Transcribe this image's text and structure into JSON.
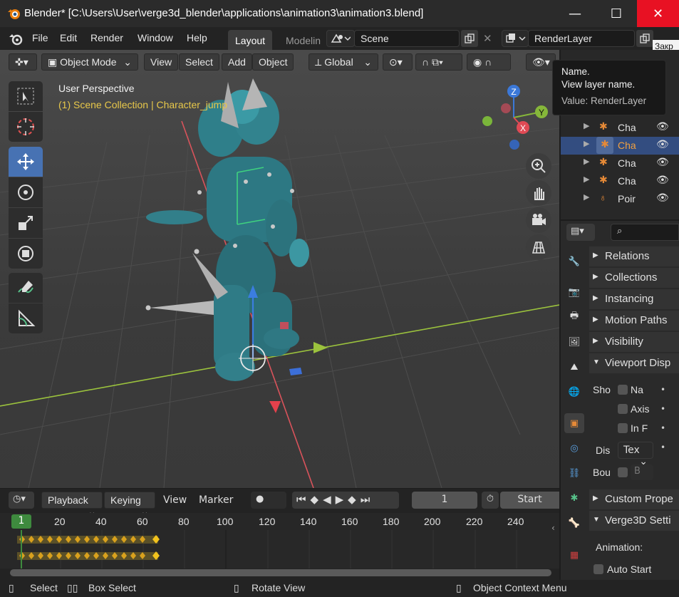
{
  "window": {
    "title": "Blender* [C:\\Users\\User\\verge3d_blender\\applications\\animation3\\animation3.blend]",
    "minimize": "—",
    "maximize": "☐",
    "close": "✕"
  },
  "menu": [
    "File",
    "Edit",
    "Render",
    "Window",
    "Help"
  ],
  "workspace_tabs": [
    "Layout",
    "Modelin"
  ],
  "scene": {
    "value": "Scene"
  },
  "view_layer": {
    "value": "RenderLayer",
    "tooltip_clip": "Закр"
  },
  "viewport_header": {
    "mode": "Object Mode",
    "menus": [
      "View",
      "Select",
      "Add",
      "Object"
    ],
    "orientation": "Global"
  },
  "overlay": {
    "title": "User Perspective",
    "subtitle": "(1) Scene Collection | Character_jump"
  },
  "gizmo": {
    "x": "X",
    "y": "Y",
    "z": "Z"
  },
  "tooltip": {
    "title": "Name.",
    "desc": "View layer name.",
    "value": "Value: RenderLayer"
  },
  "outliner": {
    "rows": [
      {
        "label": "Cha",
        "selected": false
      },
      {
        "label": "Cha",
        "selected": true
      },
      {
        "label": "Cha",
        "selected": false
      },
      {
        "label": "Cha",
        "selected": false
      },
      {
        "label": "Poir",
        "selected": false
      }
    ]
  },
  "properties": {
    "panels_closed": [
      "Relations",
      "Collections",
      "Instancing",
      "Motion Paths",
      "Visibility"
    ],
    "viewport_display": "Viewport Disp",
    "show_label": "Sho",
    "options": [
      "Na",
      "Axis",
      "In F"
    ],
    "display_label": "Dis",
    "display_value": "Tex",
    "bounds_label": "Bou",
    "bounds_value": "B",
    "custom_props": "Custom Prope",
    "verge3d": "Verge3D Setti",
    "animation_label": "Animation:",
    "auto_start": "Auto Start"
  },
  "timeline": {
    "menus": [
      "Playback",
      "Keying",
      "View",
      "Marker"
    ],
    "current_frame": "1",
    "start_label": "Start",
    "ticks": [
      "20",
      "40",
      "60",
      "80",
      "100",
      "120",
      "140",
      "160",
      "180",
      "200",
      "220",
      "240"
    ],
    "frame_badge": "1"
  },
  "status": {
    "select": "Select",
    "box_select": "Box Select",
    "rotate": "Rotate View",
    "context": "Object Context Menu"
  }
}
